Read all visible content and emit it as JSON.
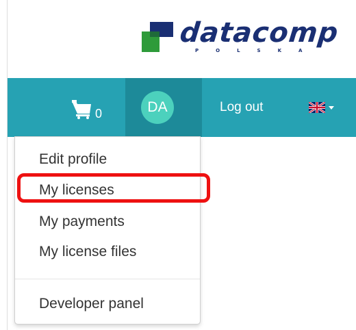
{
  "header": {
    "logo_text": "datacomp",
    "logo_subtext": "POLSKA",
    "brand_colors": {
      "logo_navy": "#1a2f73",
      "logo_green": "#2e9b3a"
    }
  },
  "navbar": {
    "background": "#26a2b3",
    "cart": {
      "icon": "cart-icon",
      "count": "0"
    },
    "user": {
      "initials": "DA",
      "avatar_color": "#4cd1bd"
    },
    "logout_label": "Log out",
    "language": {
      "icon": "uk-flag-icon"
    }
  },
  "dropdown": {
    "items": [
      {
        "label": "Edit profile"
      },
      {
        "label": "My licenses"
      },
      {
        "label": "My payments"
      },
      {
        "label": "My license files"
      }
    ],
    "footer_items": [
      {
        "label": "Developer panel"
      }
    ],
    "highlighted_item": "My licenses",
    "highlight_color": "#ee1111"
  }
}
